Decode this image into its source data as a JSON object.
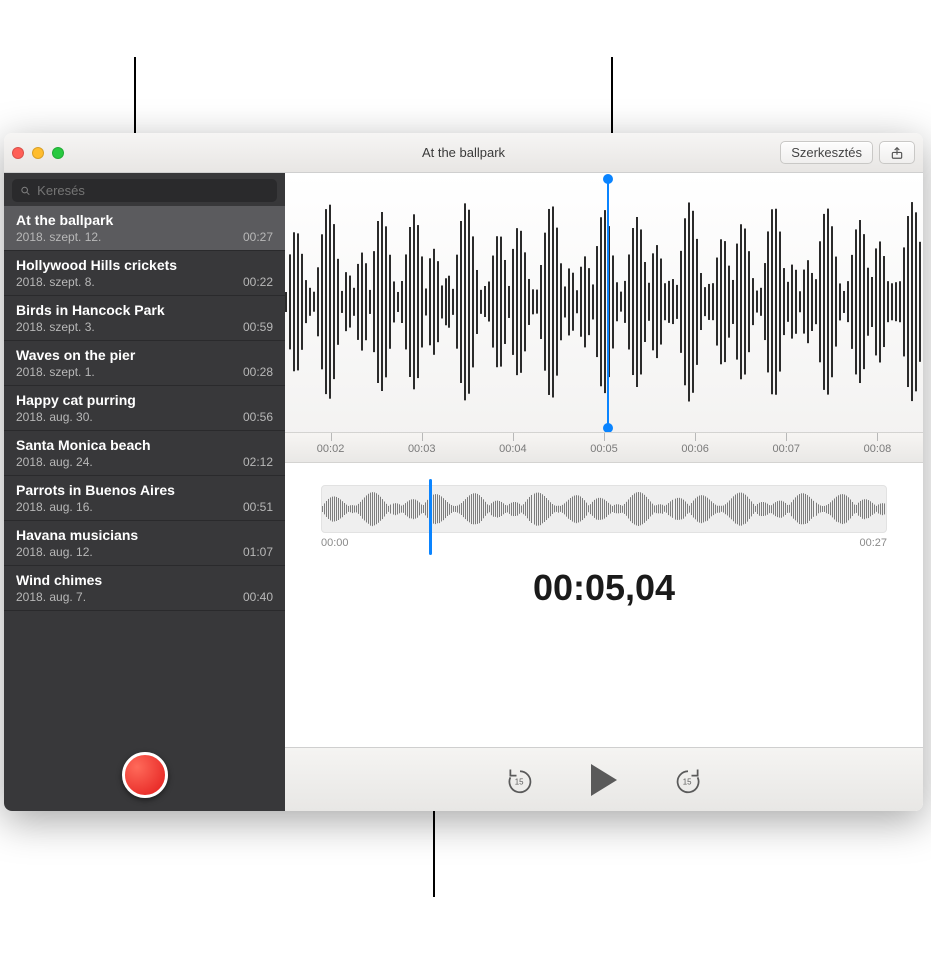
{
  "window": {
    "title": "At the ballpark"
  },
  "toolbar": {
    "edit_label": "Szerkesztés"
  },
  "search": {
    "placeholder": "Keresés"
  },
  "recordings": [
    {
      "name": "At the ballpark",
      "date": "2018. szept. 12.",
      "dur": "00:27",
      "selected": true
    },
    {
      "name": "Hollywood Hills crickets",
      "date": "2018. szept. 8.",
      "dur": "00:22"
    },
    {
      "name": "Birds in Hancock Park",
      "date": "2018. szept. 3.",
      "dur": "00:59"
    },
    {
      "name": "Waves on the pier",
      "date": "2018. szept. 1.",
      "dur": "00:28"
    },
    {
      "name": "Happy cat purring",
      "date": "2018. aug. 30.",
      "dur": "00:56"
    },
    {
      "name": "Santa Monica beach",
      "date": "2018. aug. 24.",
      "dur": "02:12"
    },
    {
      "name": "Parrots in Buenos Aires",
      "date": "2018. aug. 16.",
      "dur": "00:51"
    },
    {
      "name": "Havana musicians",
      "date": "2018. aug. 12.",
      "dur": "01:07"
    },
    {
      "name": "Wind chimes",
      "date": "2018. aug. 7.",
      "dur": "00:40"
    }
  ],
  "detail": {
    "ruler_ticks": [
      "00:02",
      "00:03",
      "00:04",
      "00:05",
      "00:06",
      "00:07",
      "00:08"
    ],
    "playhead_fraction_detail": 0.505,
    "overview": {
      "start": "00:00",
      "end": "00:27",
      "playhead_fraction": 0.19
    },
    "timecode": "00:05,04"
  }
}
